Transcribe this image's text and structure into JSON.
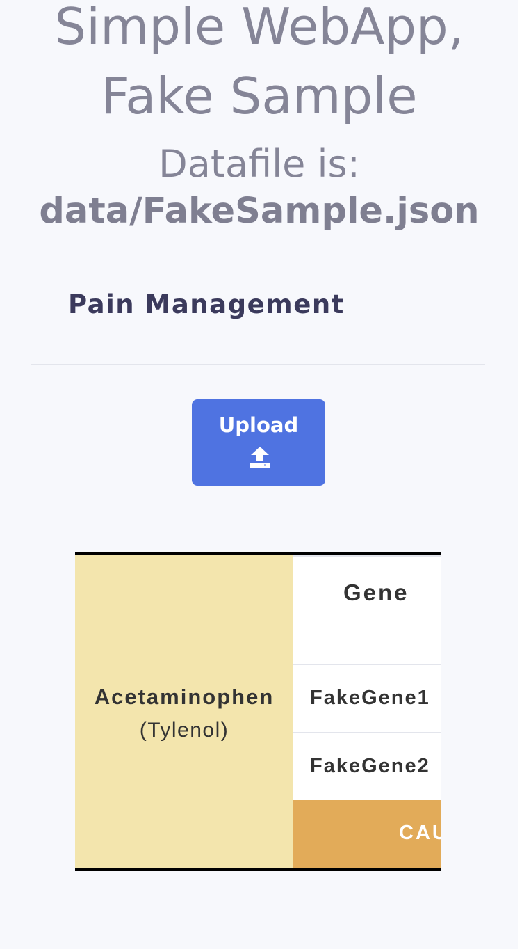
{
  "header": {
    "title_line1": "Simple WebApp,",
    "title_line2": "Fake Sample",
    "datafile_label": "Datafile is:",
    "datafile_path": "data/FakeSample.json"
  },
  "section": {
    "title": "Pain Management"
  },
  "upload": {
    "label": "Upload",
    "icon": "upload-icon"
  },
  "table": {
    "drug_name": "Acetaminophen",
    "drug_alias": "(Tylenol)",
    "gene_header": "Gene",
    "genes": [
      "FakeGene1",
      "FakeGene2"
    ],
    "status": "CAUTION"
  },
  "colors": {
    "page_bg": "#f7f8fc",
    "title_text": "#858597",
    "section_text": "#3b3a5c",
    "button_bg": "#4f73e1",
    "drug_cell_bg": "#f3e5ad",
    "status_bg": "#e2ab59"
  }
}
